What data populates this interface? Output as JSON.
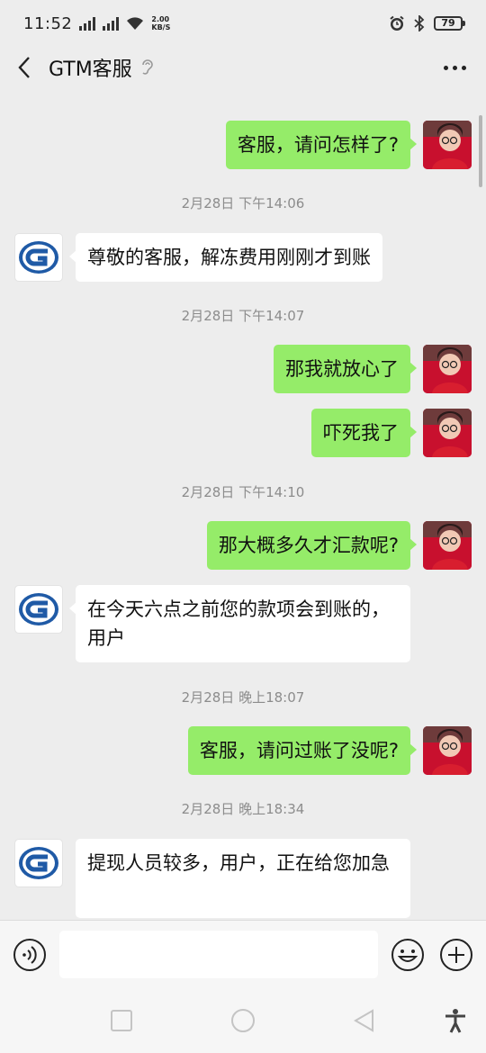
{
  "status_bar": {
    "time": "11:52",
    "net_speed_value": "2.00",
    "net_speed_unit": "KB/S",
    "battery": "79"
  },
  "header": {
    "title": "GTM客服"
  },
  "messages": [
    {
      "type": "sent",
      "text": "客服，请问怎样了?"
    },
    {
      "type": "time",
      "text": "2月28日 下午14:06"
    },
    {
      "type": "received",
      "text": "尊敬的客服，解冻费用刚刚才到账"
    },
    {
      "type": "time",
      "text": "2月28日 下午14:07"
    },
    {
      "type": "sent",
      "text": "那我就放心了"
    },
    {
      "type": "sent",
      "text": "吓死我了"
    },
    {
      "type": "time",
      "text": "2月28日 下午14:10"
    },
    {
      "type": "sent",
      "text": "那大概多久才汇款呢?"
    },
    {
      "type": "received",
      "text": "在今天六点之前您的款项会到账的，用户"
    },
    {
      "type": "time",
      "text": "2月28日 晚上18:07"
    },
    {
      "type": "sent",
      "text": "客服，请问过账了没呢?"
    },
    {
      "type": "time",
      "text": "2月28日 晚上18:34"
    },
    {
      "type": "received",
      "text": "提现人员较多，用户，正在给您加急"
    }
  ],
  "input": {
    "value": "",
    "placeholder": ""
  },
  "icons": {
    "voice": "voice-icon",
    "emoji": "emoji-icon",
    "plus": "plus-icon",
    "back": "back-arrow-icon",
    "more": "more-icon",
    "ear": "earpiece-icon"
  },
  "colors": {
    "sent_bubble": "#95ec69",
    "received_bubble": "#ffffff",
    "background": "#ededed",
    "service_logo": "#1f5aa6"
  }
}
